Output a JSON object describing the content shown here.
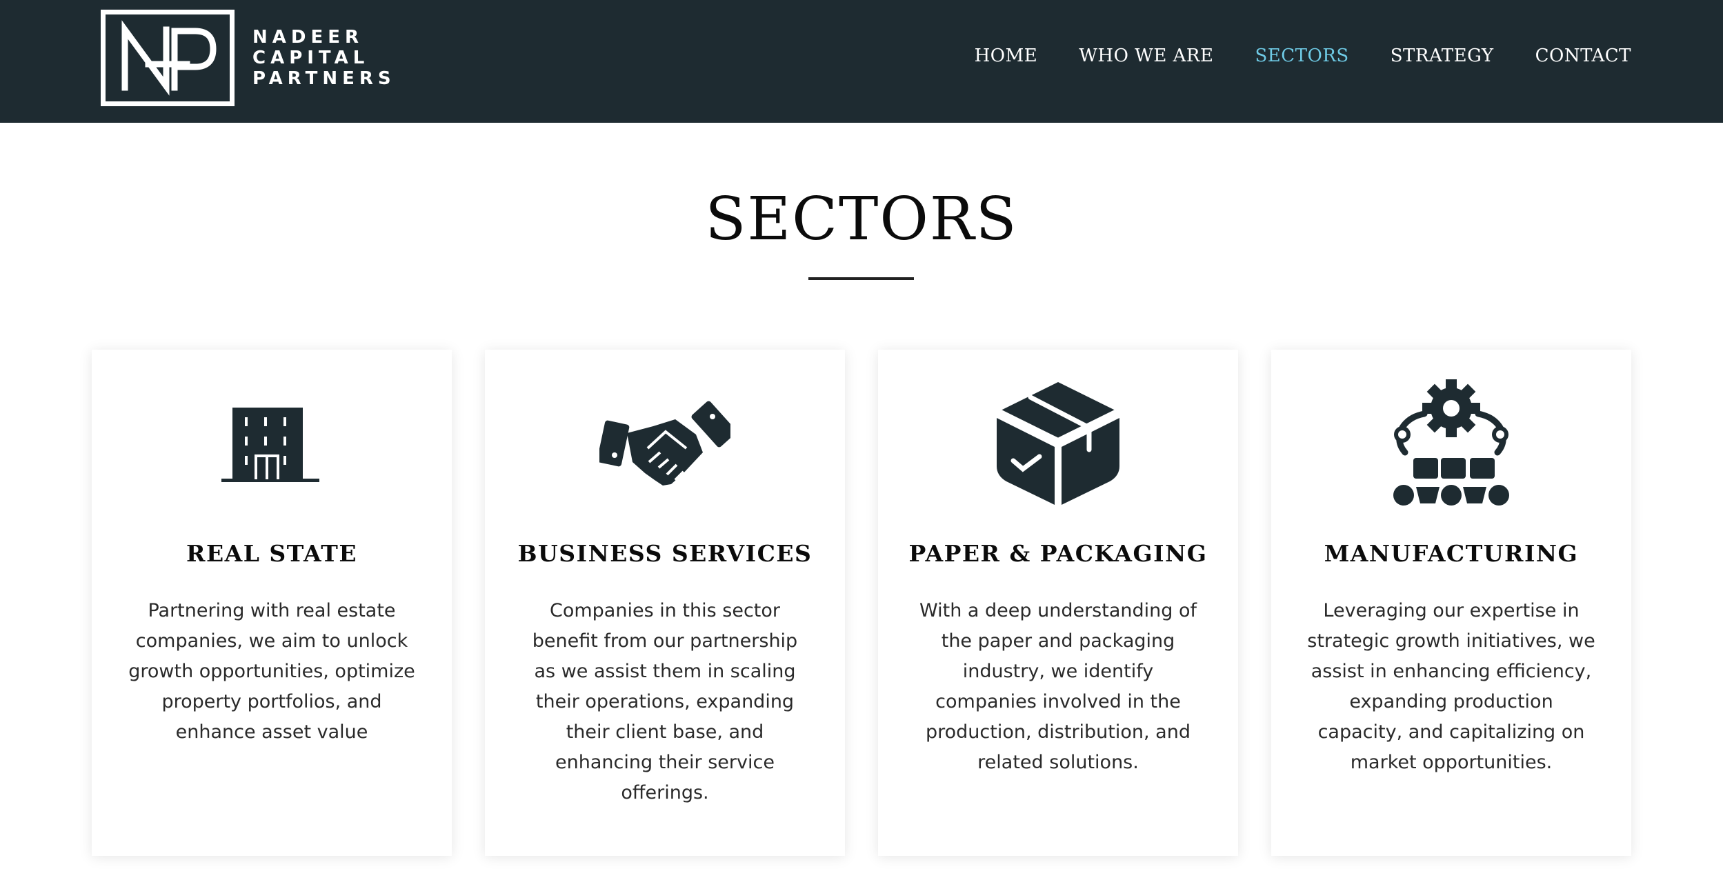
{
  "colors": {
    "header_bg": "#1e2b31",
    "accent": "#6fcbe6",
    "icon": "#1e2b31"
  },
  "logo": {
    "monogram": "NP",
    "line1": "NADEER",
    "line2": "CAPITAL",
    "line3": "PARTNERS"
  },
  "nav": {
    "items": [
      {
        "label": "HOME"
      },
      {
        "label": "WHO WE ARE"
      },
      {
        "label": "SECTORS",
        "active": true
      },
      {
        "label": "STRATEGY"
      },
      {
        "label": "CONTACT"
      }
    ]
  },
  "page": {
    "title": "SECTORS"
  },
  "sectors": [
    {
      "icon": "building-icon",
      "title": "REAL STATE",
      "text": "Partnering with real estate companies, we aim to unlock growth opportunities, optimize property portfolios, and enhance asset value"
    },
    {
      "icon": "handshake-icon",
      "title": "BUSINESS SERVICES",
      "text": "Companies in this sector benefit from our partnership as we assist them in scaling their operations, expanding their client base, and enhancing their service offerings."
    },
    {
      "icon": "box-icon",
      "title": "PAPER & PACKAGING",
      "text": "With a deep understanding of the paper and packaging industry, we identify companies involved in the production, distribution, and related solutions."
    },
    {
      "icon": "manufacturing-icon",
      "title": "MANUFACTURING",
      "text": "Leveraging our expertise in strategic growth initiatives, we assist in enhancing efficiency, expanding production capacity, and capitalizing on market opportunities."
    }
  ]
}
